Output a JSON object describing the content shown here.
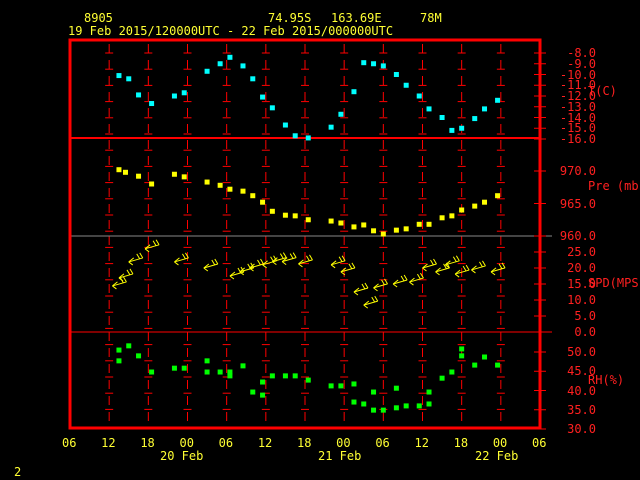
{
  "header": {
    "station": "8905",
    "lat": "74.95S",
    "lon": "163.69E",
    "elev": "78M",
    "period": "19 Feb 2015/120000UTC - 22 Feb 2015/000000UTC"
  },
  "page_number": "2",
  "colors": {
    "frame": "#ff0000",
    "temp": "#00ffff",
    "pressure": "#ffff00",
    "wind": "#ffff00",
    "rh": "#00ff00",
    "text": "#ffff33",
    "axis_text": "#ff2020"
  },
  "chart_data": [
    {
      "type": "scatter",
      "ylabel": "T(C)",
      "ylim": [
        -16,
        -8
      ],
      "yticks": [
        "-8.0",
        "-9.0",
        "-10.0",
        "-11.0",
        "-12.0",
        "-13.0",
        "-14.0",
        "-15.0",
        "-16.0"
      ],
      "points": [
        [
          "2015-02-19T13:30Z",
          -10.1
        ],
        [
          "2015-02-19T15:00Z",
          -10.4
        ],
        [
          "2015-02-19T16:30Z",
          -11.9
        ],
        [
          "2015-02-19T18:30Z",
          -12.7
        ],
        [
          "2015-02-19T22:00Z",
          -12.0
        ],
        [
          "2015-02-19T23:30Z",
          -11.7
        ],
        [
          "2015-02-20T03:00Z",
          -9.7
        ],
        [
          "2015-02-20T05:00Z",
          -9.0
        ],
        [
          "2015-02-20T06:30Z",
          -8.4
        ],
        [
          "2015-02-20T08:30Z",
          -9.2
        ],
        [
          "2015-02-20T10:00Z",
          -10.4
        ],
        [
          "2015-02-20T11:30Z",
          -12.1
        ],
        [
          "2015-02-20T13:00Z",
          -13.1
        ],
        [
          "2015-02-20T15:00Z",
          -14.7
        ],
        [
          "2015-02-20T16:30Z",
          -15.7
        ],
        [
          "2015-02-20T18:30Z",
          -15.9
        ],
        [
          "2015-02-20T22:00Z",
          -14.9
        ],
        [
          "2015-02-20T23:30Z",
          -13.7
        ],
        [
          "2015-02-21T01:30Z",
          -11.6
        ],
        [
          "2015-02-21T03:00Z",
          -8.9
        ],
        [
          "2015-02-21T04:30Z",
          -9.0
        ],
        [
          "2015-02-21T06:00Z",
          -9.2
        ],
        [
          "2015-02-21T08:00Z",
          -10.0
        ],
        [
          "2015-02-21T09:30Z",
          -11.0
        ],
        [
          "2015-02-21T11:30Z",
          -12.0
        ],
        [
          "2015-02-21T13:00Z",
          -13.2
        ],
        [
          "2015-02-21T15:00Z",
          -14.0
        ],
        [
          "2015-02-21T16:30Z",
          -15.2
        ],
        [
          "2015-02-21T18:00Z",
          -15.0
        ],
        [
          "2015-02-21T20:00Z",
          -14.1
        ],
        [
          "2015-02-21T21:30Z",
          -13.2
        ],
        [
          "2015-02-21T23:30Z",
          -12.4
        ]
      ]
    },
    {
      "type": "scatter",
      "ylabel": "Pre (mb)",
      "ylim": [
        960,
        971.3
      ],
      "yticks": [
        "970.0",
        "965.0",
        "960.0"
      ],
      "points": [
        [
          "2015-02-19T13:30Z",
          970.2
        ],
        [
          "2015-02-19T14:30Z",
          969.8
        ],
        [
          "2015-02-19T16:30Z",
          969.2
        ],
        [
          "2015-02-19T18:30Z",
          968.0
        ],
        [
          "2015-02-19T22:00Z",
          969.5
        ],
        [
          "2015-02-19T23:30Z",
          969.1
        ],
        [
          "2015-02-20T03:00Z",
          968.3
        ],
        [
          "2015-02-20T05:00Z",
          967.8
        ],
        [
          "2015-02-20T06:30Z",
          967.2
        ],
        [
          "2015-02-20T08:30Z",
          966.9
        ],
        [
          "2015-02-20T10:00Z",
          966.2
        ],
        [
          "2015-02-20T11:30Z",
          965.2
        ],
        [
          "2015-02-20T13:00Z",
          963.8
        ],
        [
          "2015-02-20T15:00Z",
          963.2
        ],
        [
          "2015-02-20T16:30Z",
          963.1
        ],
        [
          "2015-02-20T18:30Z",
          962.5
        ],
        [
          "2015-02-20T22:00Z",
          962.3
        ],
        [
          "2015-02-20T23:30Z",
          962.0
        ],
        [
          "2015-02-21T01:30Z",
          961.4
        ],
        [
          "2015-02-21T03:00Z",
          961.7
        ],
        [
          "2015-02-21T04:30Z",
          960.8
        ],
        [
          "2015-02-21T06:00Z",
          960.3
        ],
        [
          "2015-02-21T08:00Z",
          960.9
        ],
        [
          "2015-02-21T09:30Z",
          961.1
        ],
        [
          "2015-02-21T11:30Z",
          961.8
        ],
        [
          "2015-02-21T13:00Z",
          961.8
        ],
        [
          "2015-02-21T15:00Z",
          962.8
        ],
        [
          "2015-02-21T16:30Z",
          963.1
        ],
        [
          "2015-02-21T18:00Z",
          964.0
        ],
        [
          "2015-02-21T20:00Z",
          964.6
        ],
        [
          "2015-02-21T21:30Z",
          965.2
        ],
        [
          "2015-02-21T23:30Z",
          966.2
        ]
      ]
    },
    {
      "type": "scatter",
      "ylabel": "SPD(MPS)",
      "ylim": [
        0,
        25
      ],
      "yticks": [
        "25.0",
        "20.0",
        "15.0",
        "10.0",
        "5.0",
        "0.0"
      ],
      "points": [
        [
          "2015-02-19T12:30Z",
          14.4
        ],
        [
          "2015-02-19T13:30Z",
          16.9
        ],
        [
          "2015-02-19T15:00Z",
          21.9
        ],
        [
          "2015-02-19T17:30Z",
          26.0
        ],
        [
          "2015-02-19T22:00Z",
          21.9
        ],
        [
          "2015-02-20T02:30Z",
          20.0
        ],
        [
          "2015-02-20T06:30Z",
          17.5
        ],
        [
          "2015-02-20T08:00Z",
          18.8
        ],
        [
          "2015-02-20T09:30Z",
          20.0
        ],
        [
          "2015-02-20T11:30Z",
          21.0
        ],
        [
          "2015-02-20T13:00Z",
          22.0
        ],
        [
          "2015-02-20T14:30Z",
          22.0
        ],
        [
          "2015-02-20T17:00Z",
          21.3
        ],
        [
          "2015-02-20T22:00Z",
          21.0
        ],
        [
          "2015-02-20T23:30Z",
          18.8
        ],
        [
          "2015-02-21T01:30Z",
          12.5
        ],
        [
          "2015-02-21T03:00Z",
          8.4
        ],
        [
          "2015-02-21T04:30Z",
          13.8
        ],
        [
          "2015-02-21T07:30Z",
          15.0
        ],
        [
          "2015-02-21T10:00Z",
          15.6
        ],
        [
          "2015-02-21T12:00Z",
          20.0
        ],
        [
          "2015-02-21T14:00Z",
          18.8
        ],
        [
          "2015-02-21T15:30Z",
          21.0
        ],
        [
          "2015-02-21T17:00Z",
          18.1
        ],
        [
          "2015-02-21T19:30Z",
          19.4
        ],
        [
          "2015-02-21T22:30Z",
          18.8
        ]
      ]
    },
    {
      "type": "scatter",
      "ylabel": "RH(%)",
      "ylim": [
        30,
        55.2
      ],
      "yticks": [
        "50.0",
        "45.0",
        "40.0",
        "35.0",
        "30.0"
      ],
      "points": [
        [
          "2015-02-19T13:30Z",
          50.5
        ],
        [
          "2015-02-19T13:30Z",
          47.7
        ],
        [
          "2015-02-19T15:00Z",
          51.6
        ],
        [
          "2015-02-19T16:30Z",
          49.0
        ],
        [
          "2015-02-19T18:30Z",
          44.8
        ],
        [
          "2015-02-19T22:00Z",
          45.8
        ],
        [
          "2015-02-19T23:30Z",
          45.8
        ],
        [
          "2015-02-20T03:00Z",
          47.7
        ],
        [
          "2015-02-20T03:00Z",
          44.8
        ],
        [
          "2015-02-20T05:00Z",
          44.8
        ],
        [
          "2015-02-20T06:30Z",
          44.8
        ],
        [
          "2015-02-20T06:30Z",
          43.8
        ],
        [
          "2015-02-20T08:30Z",
          46.4
        ],
        [
          "2015-02-20T10:00Z",
          39.6
        ],
        [
          "2015-02-20T11:30Z",
          38.8
        ],
        [
          "2015-02-20T11:30Z",
          42.2
        ],
        [
          "2015-02-20T13:00Z",
          43.8
        ],
        [
          "2015-02-20T15:00Z",
          43.8
        ],
        [
          "2015-02-20T16:30Z",
          43.8
        ],
        [
          "2015-02-20T18:30Z",
          42.7
        ],
        [
          "2015-02-20T22:00Z",
          41.2
        ],
        [
          "2015-02-20T23:30Z",
          41.2
        ],
        [
          "2015-02-21T01:30Z",
          41.7
        ],
        [
          "2015-02-21T01:30Z",
          37.0
        ],
        [
          "2015-02-21T03:00Z",
          36.5
        ],
        [
          "2015-02-21T04:30Z",
          39.6
        ],
        [
          "2015-02-21T04:30Z",
          34.9
        ],
        [
          "2015-02-21T06:00Z",
          34.9
        ],
        [
          "2015-02-21T08:00Z",
          40.6
        ],
        [
          "2015-02-21T08:00Z",
          35.5
        ],
        [
          "2015-02-21T09:30Z",
          36.0
        ],
        [
          "2015-02-21T11:30Z",
          36.0
        ],
        [
          "2015-02-21T13:00Z",
          39.6
        ],
        [
          "2015-02-21T13:00Z",
          36.5
        ],
        [
          "2015-02-21T15:00Z",
          43.2
        ],
        [
          "2015-02-21T16:30Z",
          44.8
        ],
        [
          "2015-02-21T18:00Z",
          50.8
        ],
        [
          "2015-02-21T18:00Z",
          49.0
        ],
        [
          "2015-02-21T20:00Z",
          46.6
        ],
        [
          "2015-02-21T21:30Z",
          48.7
        ],
        [
          "2015-02-21T23:30Z",
          46.6
        ]
      ]
    }
  ],
  "x_axis": {
    "range": [
      "2015-02-19T06:00Z",
      "2015-02-22T06:00Z"
    ],
    "hour_ticks": [
      "06",
      "12",
      "18",
      "00",
      "06",
      "12",
      "18",
      "00",
      "06",
      "12",
      "18",
      "00",
      "06"
    ],
    "day_labels": [
      "20 Feb",
      "21 Feb",
      "22 Feb"
    ]
  }
}
